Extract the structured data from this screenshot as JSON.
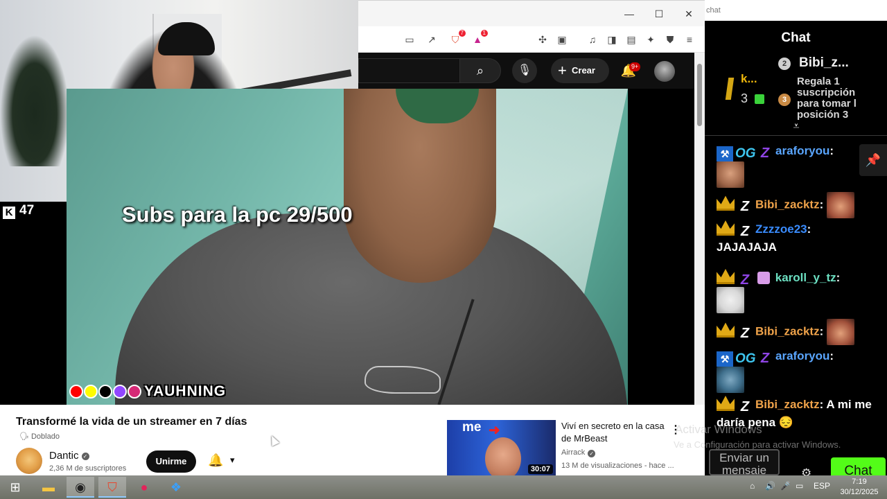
{
  "stream": {
    "viewer_count": "47",
    "subs_goal": "Subs para la pc 29/500",
    "social_handle": "YAUHNING"
  },
  "browser": {
    "window_buttons": {
      "minimize": "—",
      "maximize": "☐",
      "close": "✕"
    },
    "toolbar_badges": {
      "shield": "7",
      "rewards": "1"
    }
  },
  "youtube": {
    "create_label": "Crear",
    "notification_badge": "9+",
    "video": {
      "title": "Transformé la vida de un streamer en 7 días",
      "dubbed_label": "Doblado",
      "channel_name": "Dantic",
      "subscribers": "2,36 M de suscriptores",
      "join_label": "Unirme"
    },
    "recommended": {
      "thumb_text": "me",
      "duration": "30:07",
      "title": "Viví en secreto en la casa de MrBeast",
      "channel": "Airrack",
      "meta": "13 M de visualizaciones - hace ..."
    }
  },
  "chat": {
    "url_text": "chat",
    "header": "Chat",
    "leaderboard": {
      "first_name": "k...",
      "first_count": "3",
      "second_rank": "2",
      "second_name": "Bibi_z...",
      "third_rank": "3",
      "third_text": "Regala 1 suscripción para tomar l posición 3"
    },
    "messages": [
      {
        "user": "araforyou",
        "text": ""
      },
      {
        "user": "Bibi_zacktz",
        "text": ""
      },
      {
        "user": "Zzzzoe23",
        "text": "JAJAJAJA"
      },
      {
        "user": "karoll_y_tz",
        "text": ""
      },
      {
        "user": "Bibi_zacktz",
        "text": ""
      },
      {
        "user": "araforyou",
        "text": ""
      },
      {
        "user": "Bibi_zacktz",
        "text": "A mi me daría pena 😔"
      }
    ],
    "og_badge": "OG",
    "input_placeholder": "Enviar un mensaje",
    "send_label": "Chat"
  },
  "windows": {
    "watermark_title": "Activar Windows",
    "watermark_subtitle": "Ve a Configuración para activar Windows.",
    "language": "ESP",
    "time": "7:19",
    "date": "30/12/2025"
  }
}
